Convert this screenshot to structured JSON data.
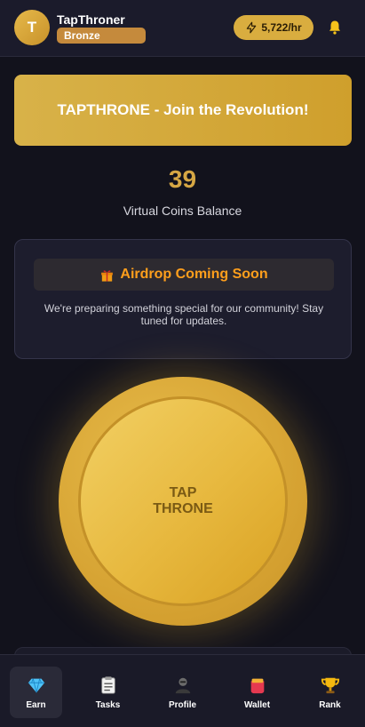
{
  "user": {
    "initial": "T",
    "name": "TapThroner",
    "rank": "Bronze"
  },
  "header": {
    "rate": "5,722/hr",
    "rate_icon": "lightning-icon",
    "notification_icon": "bell-icon"
  },
  "banner": {
    "text": "TAPTHRONE - Join the Revolution!"
  },
  "balance": {
    "value": "39",
    "label": "Virtual Coins Balance"
  },
  "airdrop": {
    "icon": "gift-icon",
    "title": "Airdrop Coming Soon",
    "description": "We're preparing something special for our community! Stay tuned for updates."
  },
  "coin": {
    "line1": "TAP",
    "line2": "THRONE"
  },
  "nav": {
    "items": [
      {
        "label": "Earn",
        "icon": "diamond-icon",
        "active": true
      },
      {
        "label": "Tasks",
        "icon": "clipboard-icon",
        "active": false
      },
      {
        "label": "Profile",
        "icon": "person-icon",
        "active": false
      },
      {
        "label": "Wallet",
        "icon": "wallet-icon",
        "active": false
      },
      {
        "label": "Rank",
        "icon": "trophy-icon",
        "active": false
      }
    ]
  },
  "colors": {
    "background": "#12121c",
    "gold": "#d6a744",
    "airdrop_orange": "#ff9f1c"
  }
}
